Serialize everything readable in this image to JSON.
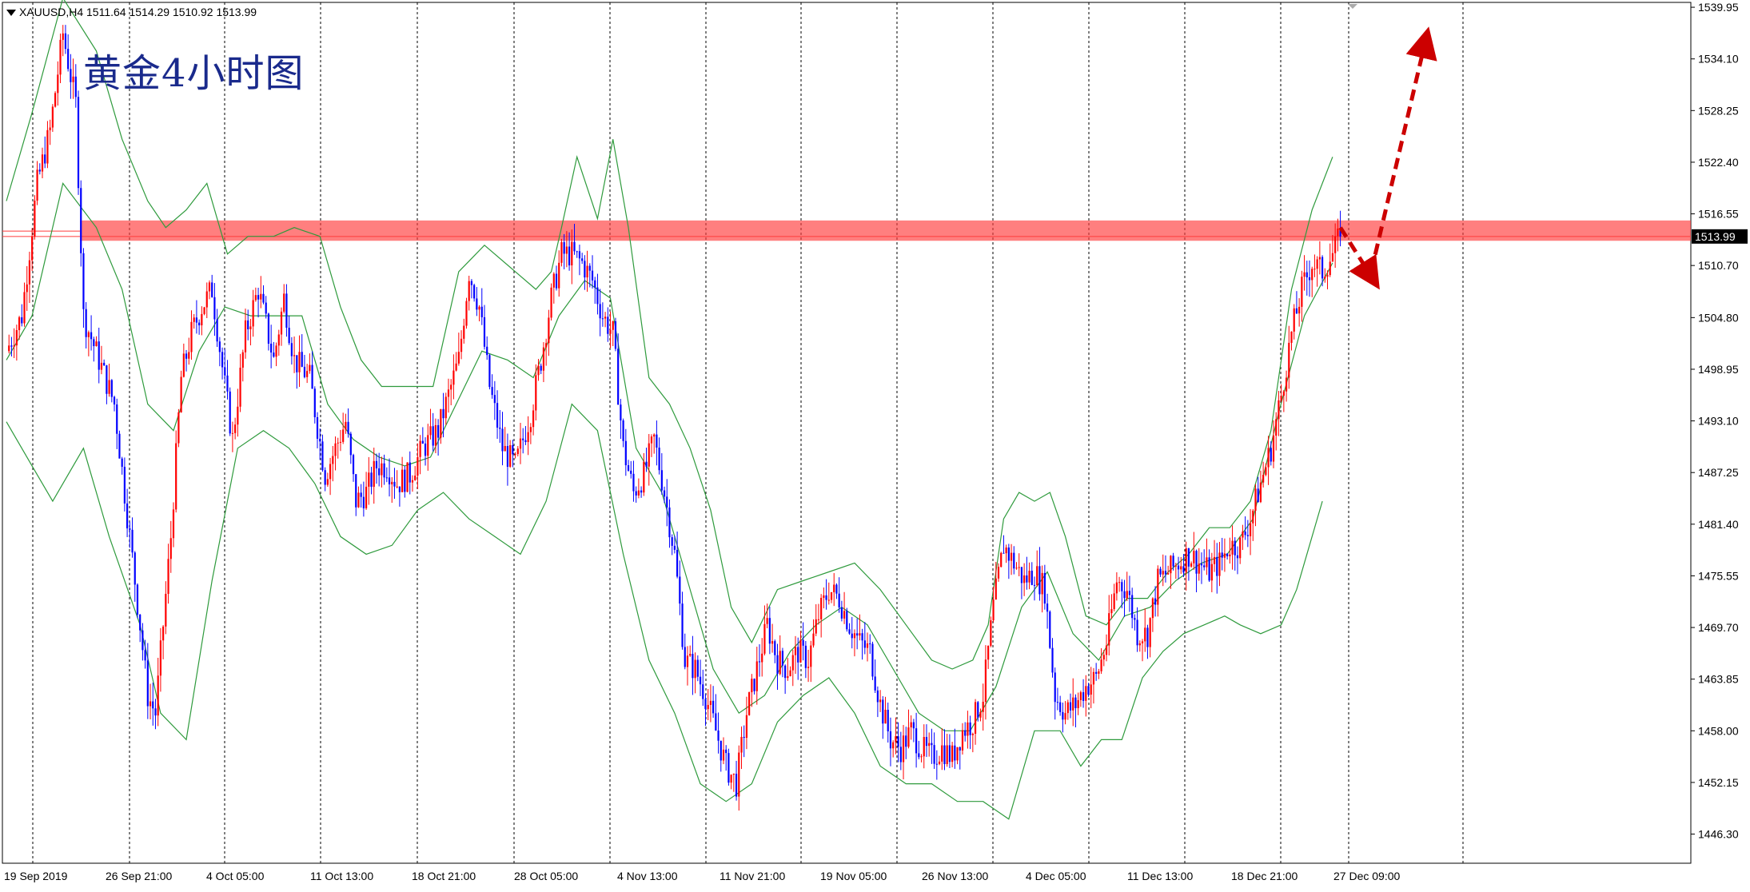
{
  "header": {
    "symbol": "XAUUSD,H4",
    "ohlc": "1511.64 1514.29 1510.92 1513.99"
  },
  "overlay_label": "黄金4小时图",
  "colors": {
    "bull_candle": "#ff0000",
    "bear_candle": "#0000ff",
    "bollinger": "#2e9a3c",
    "zone": "#ff3b3b",
    "arrow": "#cc0000",
    "price_tag_bg": "#000000"
  },
  "chart_data": {
    "type": "candlestick",
    "symbol": "XAUUSD",
    "timeframe": "H4",
    "ylim": [
      1443.0,
      1540.5
    ],
    "y_ticks": [
      "1539.95",
      "1534.10",
      "1528.25",
      "1522.40",
      "1516.55",
      "1510.70",
      "1504.80",
      "1498.95",
      "1493.10",
      "1487.25",
      "1481.40",
      "1475.55",
      "1469.70",
      "1463.85",
      "1458.00",
      "1452.15",
      "1446.30"
    ],
    "x_ticks": [
      "19 Sep 2019",
      "26 Sep 21:00",
      "4 Oct 05:00",
      "11 Oct 13:00",
      "18 Oct 21:00",
      "28 Oct 05:00",
      "4 Nov 13:00",
      "11 Nov 21:00",
      "19 Nov 05:00",
      "26 Nov 13:00",
      "4 Dec 05:00",
      "11 Dec 13:00",
      "18 Dec 21:00",
      "27 Dec 09:00"
    ],
    "current_price": "1513.99",
    "resistance_zone": [
      1513.5,
      1515.8
    ],
    "price_path": [
      [
        0,
        1501
      ],
      [
        6,
        1505
      ],
      [
        12,
        1520
      ],
      [
        17,
        1526
      ],
      [
        22,
        1537
      ],
      [
        27,
        1529
      ],
      [
        30,
        1505
      ],
      [
        36,
        1500
      ],
      [
        42,
        1495
      ],
      [
        48,
        1480
      ],
      [
        52,
        1470
      ],
      [
        55,
        1462
      ],
      [
        58,
        1460
      ],
      [
        64,
        1480
      ],
      [
        68,
        1498
      ],
      [
        72,
        1503
      ],
      [
        76,
        1506
      ],
      [
        80,
        1508
      ],
      [
        85,
        1497
      ],
      [
        88,
        1491
      ],
      [
        93,
        1503
      ],
      [
        98,
        1508
      ],
      [
        104,
        1500
      ],
      [
        108,
        1507
      ],
      [
        112,
        1500
      ],
      [
        118,
        1498
      ],
      [
        124,
        1487
      ],
      [
        128,
        1490
      ],
      [
        132,
        1493
      ],
      [
        136,
        1484
      ],
      [
        140,
        1485
      ],
      [
        144,
        1488
      ],
      [
        148,
        1488
      ],
      [
        152,
        1486
      ],
      [
        157,
        1487
      ],
      [
        162,
        1490
      ],
      [
        168,
        1492
      ],
      [
        172,
        1496
      ],
      [
        176,
        1500
      ],
      [
        180,
        1510
      ],
      [
        184,
        1506
      ],
      [
        188,
        1497
      ],
      [
        193,
        1490
      ],
      [
        198,
        1488
      ],
      [
        204,
        1494
      ],
      [
        208,
        1500
      ],
      [
        212,
        1507
      ],
      [
        216,
        1512
      ],
      [
        220,
        1512
      ],
      [
        224,
        1511
      ],
      [
        228,
        1509
      ],
      [
        232,
        1505
      ],
      [
        236,
        1503
      ],
      [
        240,
        1490
      ],
      [
        244,
        1485
      ],
      [
        248,
        1487
      ],
      [
        252,
        1491
      ],
      [
        256,
        1485
      ],
      [
        260,
        1478
      ],
      [
        264,
        1466
      ],
      [
        268,
        1465
      ],
      [
        272,
        1462
      ],
      [
        276,
        1458
      ],
      [
        280,
        1454
      ],
      [
        284,
        1452
      ],
      [
        288,
        1460
      ],
      [
        292,
        1465
      ],
      [
        296,
        1470
      ],
      [
        300,
        1466
      ],
      [
        304,
        1465
      ],
      [
        308,
        1467
      ],
      [
        312,
        1466
      ],
      [
        316,
        1471
      ],
      [
        320,
        1474
      ],
      [
        324,
        1473
      ],
      [
        328,
        1470
      ],
      [
        332,
        1468
      ],
      [
        336,
        1467
      ],
      [
        340,
        1461
      ],
      [
        344,
        1457
      ],
      [
        348,
        1456
      ],
      [
        352,
        1458
      ],
      [
        356,
        1456
      ],
      [
        360,
        1455
      ],
      [
        364,
        1456
      ],
      [
        368,
        1455
      ],
      [
        372,
        1458
      ],
      [
        376,
        1459
      ],
      [
        380,
        1462
      ],
      [
        384,
        1472
      ],
      [
        388,
        1479
      ],
      [
        392,
        1477
      ],
      [
        396,
        1475
      ],
      [
        400,
        1476
      ],
      [
        404,
        1474
      ],
      [
        408,
        1462
      ],
      [
        412,
        1460
      ],
      [
        416,
        1461
      ],
      [
        420,
        1463
      ],
      [
        424,
        1464
      ],
      [
        428,
        1468
      ],
      [
        432,
        1475
      ],
      [
        436,
        1474
      ],
      [
        440,
        1469
      ],
      [
        444,
        1469
      ],
      [
        448,
        1475
      ],
      [
        452,
        1476
      ],
      [
        456,
        1477
      ],
      [
        460,
        1478
      ],
      [
        464,
        1477
      ],
      [
        468,
        1476
      ],
      [
        472,
        1477
      ],
      [
        476,
        1479
      ],
      [
        480,
        1479
      ],
      [
        484,
        1482
      ],
      [
        488,
        1486
      ],
      [
        492,
        1490
      ],
      [
        496,
        1496
      ],
      [
        500,
        1503
      ],
      [
        504,
        1508
      ],
      [
        508,
        1511
      ],
      [
        512,
        1510
      ],
      [
        516,
        1512
      ],
      [
        519,
        1514
      ]
    ],
    "bollinger_upper": [
      [
        0,
        1518
      ],
      [
        10,
        1528
      ],
      [
        22,
        1541
      ],
      [
        35,
        1535
      ],
      [
        45,
        1525
      ],
      [
        55,
        1518
      ],
      [
        62,
        1515
      ],
      [
        70,
        1517
      ],
      [
        78,
        1520
      ],
      [
        86,
        1512
      ],
      [
        94,
        1514
      ],
      [
        104,
        1514
      ],
      [
        112,
        1515
      ],
      [
        122,
        1514
      ],
      [
        130,
        1506
      ],
      [
        138,
        1500
      ],
      [
        146,
        1497
      ],
      [
        156,
        1497
      ],
      [
        166,
        1497
      ],
      [
        176,
        1510
      ],
      [
        186,
        1513
      ],
      [
        198,
        1510
      ],
      [
        206,
        1508
      ],
      [
        212,
        1510
      ],
      [
        216,
        1515
      ],
      [
        222,
        1523
      ],
      [
        230,
        1516
      ],
      [
        236,
        1525
      ],
      [
        242,
        1515
      ],
      [
        250,
        1498
      ],
      [
        258,
        1495
      ],
      [
        266,
        1490
      ],
      [
        274,
        1483
      ],
      [
        282,
        1472
      ],
      [
        290,
        1468
      ],
      [
        300,
        1474
      ],
      [
        310,
        1475
      ],
      [
        320,
        1476
      ],
      [
        330,
        1477
      ],
      [
        340,
        1474
      ],
      [
        350,
        1470
      ],
      [
        360,
        1466
      ],
      [
        368,
        1465
      ],
      [
        376,
        1466
      ],
      [
        382,
        1470
      ],
      [
        388,
        1482
      ],
      [
        394,
        1485
      ],
      [
        400,
        1484
      ],
      [
        406,
        1485
      ],
      [
        412,
        1480
      ],
      [
        420,
        1471
      ],
      [
        428,
        1470
      ],
      [
        436,
        1473
      ],
      [
        444,
        1473
      ],
      [
        452,
        1476
      ],
      [
        460,
        1478
      ],
      [
        468,
        1481
      ],
      [
        476,
        1481
      ],
      [
        484,
        1484
      ],
      [
        492,
        1492
      ],
      [
        500,
        1508
      ],
      [
        508,
        1517
      ],
      [
        516,
        1523
      ]
    ],
    "bollinger_middle": [
      [
        0,
        1500
      ],
      [
        10,
        1505
      ],
      [
        22,
        1520
      ],
      [
        35,
        1515
      ],
      [
        45,
        1508
      ],
      [
        55,
        1495
      ],
      [
        65,
        1492
      ],
      [
        75,
        1501
      ],
      [
        85,
        1506
      ],
      [
        95,
        1505
      ],
      [
        105,
        1505
      ],
      [
        115,
        1505
      ],
      [
        125,
        1495
      ],
      [
        135,
        1491
      ],
      [
        145,
        1489
      ],
      [
        155,
        1488
      ],
      [
        165,
        1489
      ],
      [
        175,
        1495
      ],
      [
        185,
        1501
      ],
      [
        195,
        1500
      ],
      [
        205,
        1498
      ],
      [
        215,
        1505
      ],
      [
        225,
        1509
      ],
      [
        235,
        1507
      ],
      [
        245,
        1490
      ],
      [
        255,
        1485
      ],
      [
        265,
        1475
      ],
      [
        275,
        1465
      ],
      [
        285,
        1460
      ],
      [
        295,
        1462
      ],
      [
        305,
        1467
      ],
      [
        315,
        1470
      ],
      [
        325,
        1472
      ],
      [
        335,
        1470
      ],
      [
        345,
        1465
      ],
      [
        355,
        1460
      ],
      [
        365,
        1458
      ],
      [
        375,
        1458
      ],
      [
        385,
        1463
      ],
      [
        395,
        1472
      ],
      [
        405,
        1476
      ],
      [
        415,
        1469
      ],
      [
        425,
        1466
      ],
      [
        435,
        1471
      ],
      [
        445,
        1472
      ],
      [
        455,
        1475
      ],
      [
        465,
        1477
      ],
      [
        475,
        1478
      ],
      [
        485,
        1482
      ],
      [
        495,
        1494
      ],
      [
        505,
        1505
      ],
      [
        516,
        1511
      ]
    ],
    "bollinger_lower": [
      [
        0,
        1493
      ],
      [
        10,
        1488
      ],
      [
        18,
        1484
      ],
      [
        30,
        1490
      ],
      [
        40,
        1480
      ],
      [
        52,
        1470
      ],
      [
        60,
        1460
      ],
      [
        70,
        1457
      ],
      [
        80,
        1475
      ],
      [
        90,
        1490
      ],
      [
        100,
        1492
      ],
      [
        110,
        1490
      ],
      [
        120,
        1486
      ],
      [
        130,
        1480
      ],
      [
        140,
        1478
      ],
      [
        150,
        1479
      ],
      [
        160,
        1483
      ],
      [
        170,
        1485
      ],
      [
        180,
        1482
      ],
      [
        190,
        1480
      ],
      [
        200,
        1478
      ],
      [
        210,
        1484
      ],
      [
        220,
        1495
      ],
      [
        230,
        1492
      ],
      [
        240,
        1478
      ],
      [
        250,
        1466
      ],
      [
        260,
        1460
      ],
      [
        270,
        1452
      ],
      [
        280,
        1450
      ],
      [
        290,
        1452
      ],
      [
        300,
        1459
      ],
      [
        310,
        1462
      ],
      [
        320,
        1464
      ],
      [
        330,
        1460
      ],
      [
        340,
        1454
      ],
      [
        350,
        1452
      ],
      [
        360,
        1452
      ],
      [
        370,
        1450
      ],
      [
        380,
        1450
      ],
      [
        390,
        1448
      ],
      [
        400,
        1458
      ],
      [
        410,
        1458
      ],
      [
        418,
        1454
      ],
      [
        426,
        1457
      ],
      [
        434,
        1457
      ],
      [
        442,
        1464
      ],
      [
        450,
        1467
      ],
      [
        458,
        1469
      ],
      [
        466,
        1470
      ],
      [
        474,
        1471
      ],
      [
        480,
        1470
      ],
      [
        488,
        1469
      ],
      [
        496,
        1470
      ],
      [
        502,
        1474
      ],
      [
        508,
        1480
      ],
      [
        512,
        1484
      ]
    ],
    "arrows": [
      {
        "from": [
          519,
          1515.0
        ],
        "to": [
          531,
          1509.5
        ]
      },
      {
        "from": [
          531,
          1510.0
        ],
        "to": [
          552,
          1536.0
        ]
      }
    ]
  }
}
